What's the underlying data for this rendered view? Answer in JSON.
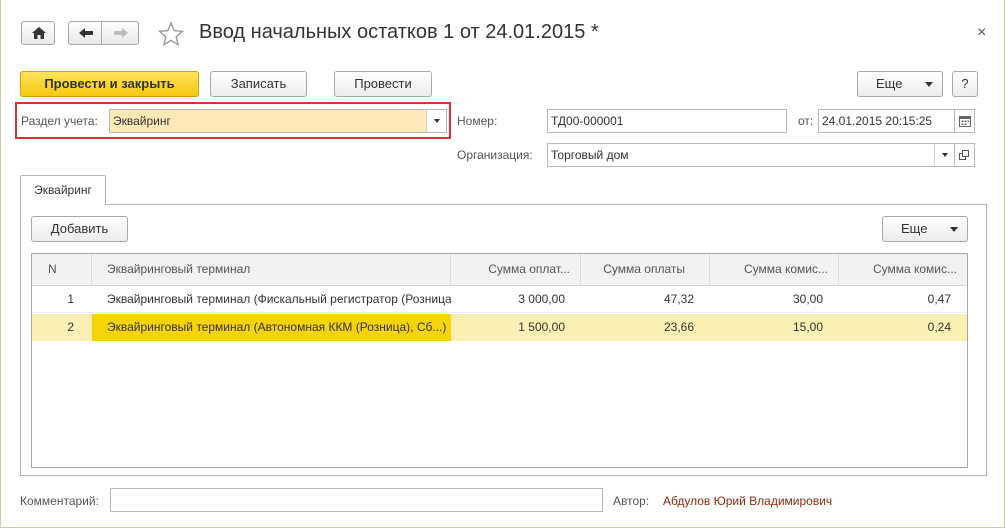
{
  "window": {
    "title": "Ввод начальных остатков 1 от 24.01.2015 *",
    "close_glyph": "×"
  },
  "toolbar": {
    "post_and_close": "Провести и закрыть",
    "save": "Записать",
    "post": "Провести",
    "more": "Еще",
    "help": "?"
  },
  "form": {
    "section_label": "Раздел учета:",
    "section_value": "Эквайринг",
    "number_label": "Номер:",
    "number_value": "ТД00-000001",
    "date_label": "от:",
    "date_value": "24.01.2015 20:15:25",
    "org_label": "Организация:",
    "org_value": "Торговый дом",
    "comment_label": "Комментарий:",
    "comment_value": "",
    "author_label": "Автор:",
    "author_value": "Абдулов Юрий Владимирович"
  },
  "tabs": [
    {
      "label": "Эквайринг",
      "active": true
    }
  ],
  "table_toolbar": {
    "add": "Добавить",
    "more": "Еще"
  },
  "table": {
    "columns": [
      "N",
      "Эквайринговый терминал",
      "Сумма оплат...",
      "Сумма оплаты",
      "Сумма комис...",
      "Сумма комис..."
    ],
    "rows": [
      {
        "n": "1",
        "terminal": "Эквайринговый терминал  (Фискальный регистратор (Розница), Сб...)",
        "sum1": "3 000,00",
        "sum2": "47,32",
        "fee1": "30,00",
        "fee2": "0,47",
        "selected": false
      },
      {
        "n": "2",
        "terminal": "Эквайринговый терминал  (Автономная ККМ (Розница), Сб...)",
        "sum1": "1 500,00",
        "sum2": "23,66",
        "fee1": "15,00",
        "fee2": "0,24",
        "selected": true
      }
    ]
  },
  "colors": {
    "primary_button": "#f5c810",
    "selected_row": "#fbf0b3",
    "current_cell": "#f7d40a",
    "highlight_border": "#d9303a",
    "author_link": "#8b2a10"
  },
  "icons": [
    "home-icon",
    "back-arrow-icon",
    "forward-arrow-icon",
    "favorite-star-icon",
    "close-icon",
    "calendar-icon",
    "open-icon",
    "chevron-down-icon"
  ]
}
